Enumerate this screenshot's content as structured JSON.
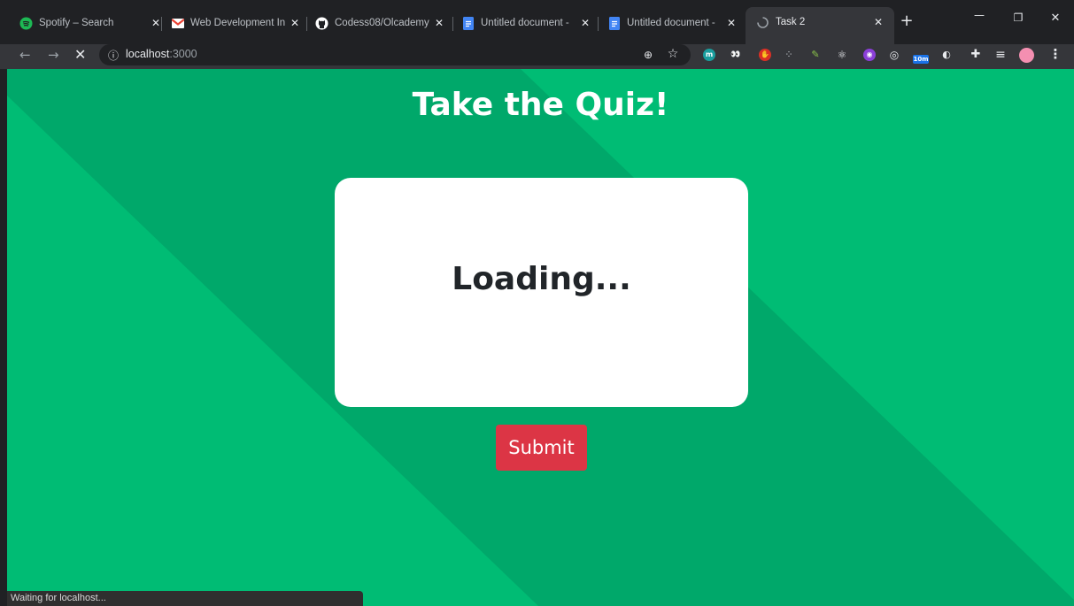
{
  "browser": {
    "tabs": [
      {
        "title": "Spotify – Search",
        "icon": "spotify-icon",
        "color": "#1db954"
      },
      {
        "title": "Web Development In",
        "icon": "gmail-icon",
        "color": "#ea4335"
      },
      {
        "title": "Codess08/Olcademy",
        "icon": "github-icon",
        "color": "#ffffff"
      },
      {
        "title": "Untitled document -",
        "icon": "docs-icon",
        "color": "#4285f4"
      },
      {
        "title": "Untitled document -",
        "icon": "docs-icon",
        "color": "#4285f4"
      },
      {
        "title": "Task 2",
        "icon": "loading-icon",
        "active": true
      }
    ],
    "close_glyph": "✕",
    "new_tab_glyph": "+",
    "window": {
      "minimize": "—",
      "restore": "❐",
      "close": "✕"
    },
    "nav": {
      "back": "←",
      "forward": "→",
      "stop": "✕"
    },
    "address": {
      "info_icon": "ⓘ",
      "host": "localhost",
      "port": ":3000"
    },
    "extensions": [
      {
        "name": "zoom-icon",
        "glyph": "⊕"
      },
      {
        "name": "bookmark-star-icon",
        "glyph": "☆"
      },
      {
        "name": "ext-m-icon",
        "glyph": "m",
        "color": "#1a9e9e"
      },
      {
        "name": "ext-eyes-icon",
        "glyph": "👀",
        "color": "#35363a"
      },
      {
        "name": "ext-stop-icon",
        "glyph": "✋",
        "color": "#d93025"
      },
      {
        "name": "ext-bottle-icon",
        "glyph": "⁘",
        "color": "#35363a"
      },
      {
        "name": "ext-pencil-icon",
        "glyph": "✎",
        "color": "#35363a"
      },
      {
        "name": "ext-react-icon",
        "glyph": "⚛",
        "color": "#35363a"
      },
      {
        "name": "ext-purple-icon",
        "glyph": "◉",
        "color": "#8b3fd9"
      },
      {
        "name": "ext-target-icon",
        "glyph": "◎",
        "color": "#35363a"
      },
      {
        "name": "ext-timer-icon",
        "glyph": "10m",
        "color": "#1a73e8"
      },
      {
        "name": "ext-moon-icon",
        "glyph": "◐",
        "color": "#35363a"
      },
      {
        "name": "extensions-puzzle-icon",
        "glyph": "✚"
      },
      {
        "name": "reading-list-icon",
        "glyph": "≡"
      },
      {
        "name": "profile-avatar-icon",
        "glyph": "●",
        "color": "#f48fb1"
      },
      {
        "name": "menu-dots-icon",
        "glyph": "⋮"
      }
    ]
  },
  "page": {
    "title": "Take the Quiz!",
    "card_text": "Loading...",
    "submit_label": "Submit",
    "background_color": "#00bc74",
    "stripe_color": "#00a86a",
    "submit_color": "#dc3545"
  },
  "status_bar": {
    "text": "Waiting for localhost..."
  }
}
